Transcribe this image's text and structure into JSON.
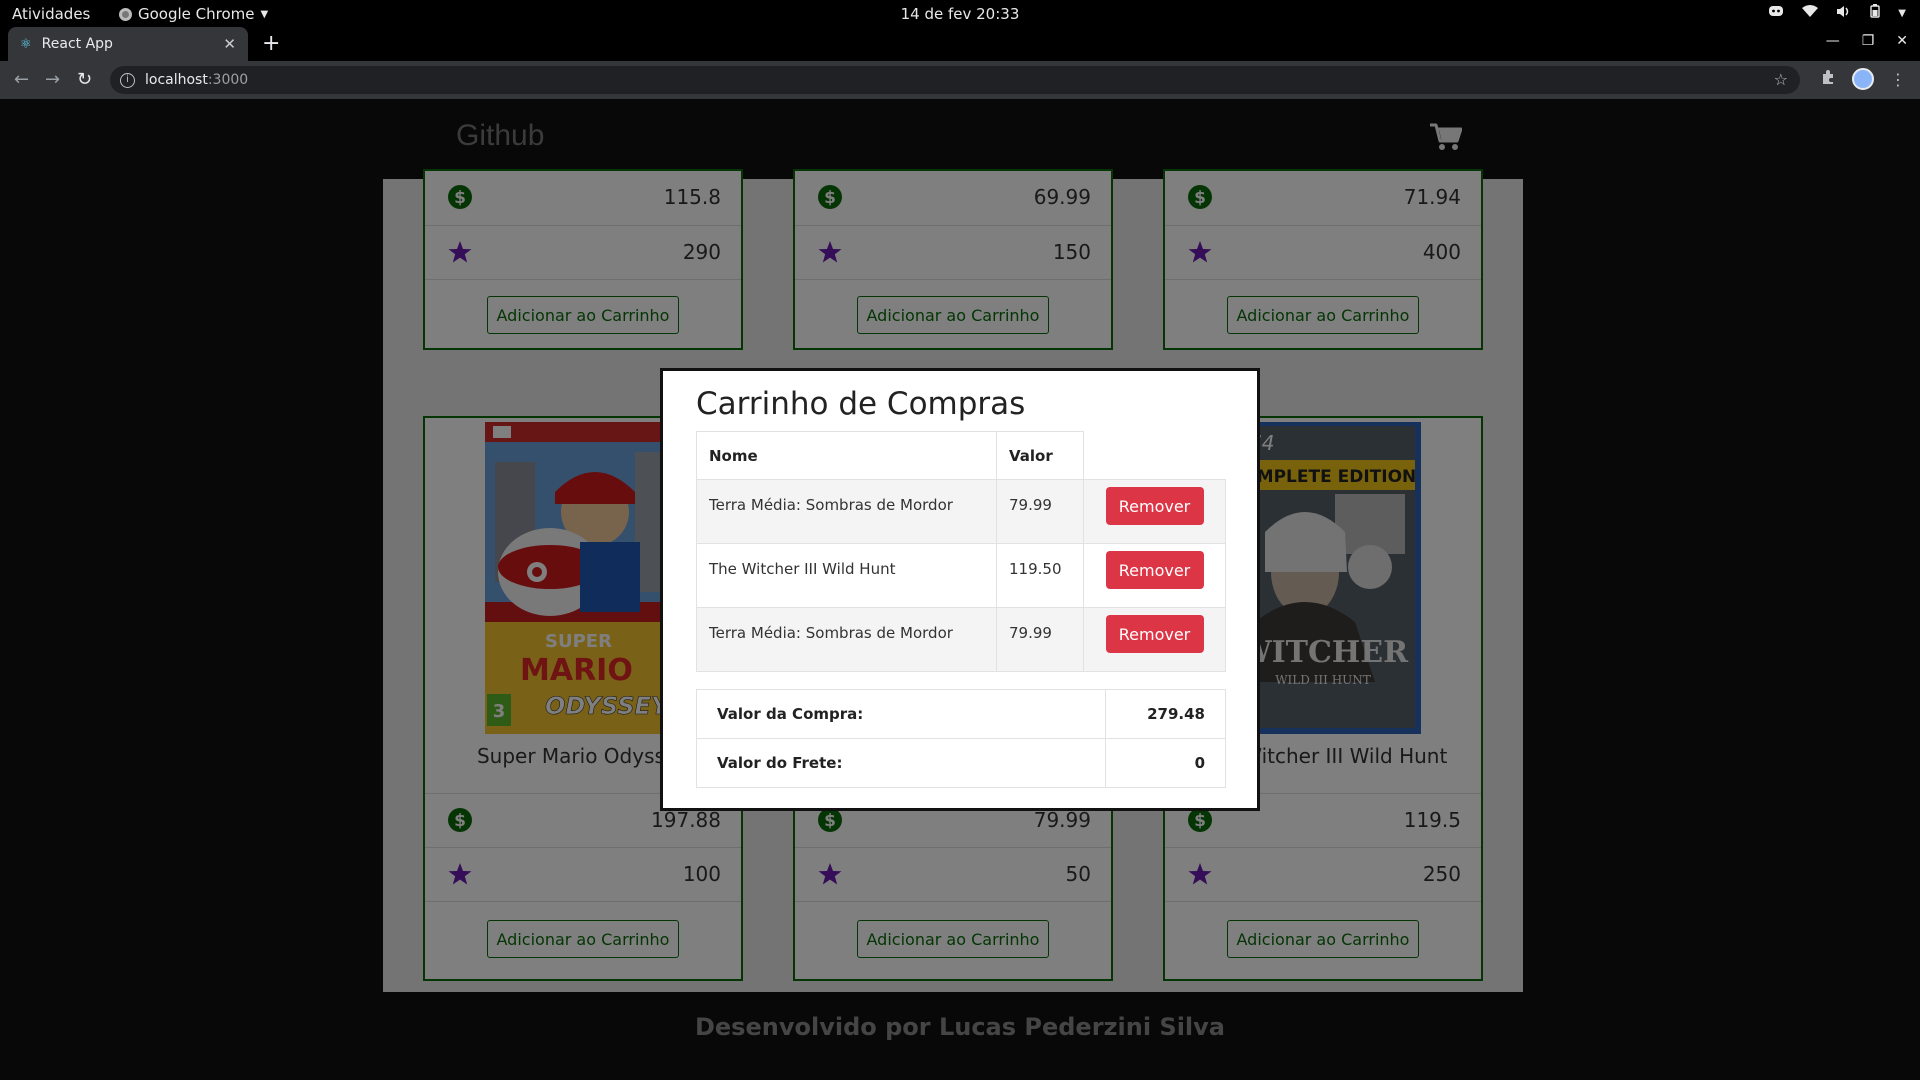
{
  "os": {
    "activities": "Atividades",
    "app_name": "Google Chrome",
    "clock": "14 de fev  20:33"
  },
  "browser": {
    "tab_title": "React App",
    "url_host": "localhost",
    "url_port": ":3000"
  },
  "site": {
    "brand": "Github",
    "footer": "Desenvolvido por Lucas Pederzini Silva",
    "add_label": "Adicionar ao Carrinho",
    "accent_color": "#0a6b0a",
    "star_color": "#6a1bb0",
    "top_cards": [
      {
        "price": "115.8",
        "score": "290"
      },
      {
        "price": "69.99",
        "score": "150"
      },
      {
        "price": "71.94",
        "score": "400"
      }
    ],
    "bottom_cards": [
      {
        "name": "Super Mario Odyssey",
        "price": "197.88",
        "score": "100"
      },
      {
        "name": "",
        "price": "79.99",
        "score": "50"
      },
      {
        "name": "The Witcher III Wild Hunt",
        "price": "119.5",
        "score": "250"
      }
    ]
  },
  "modal": {
    "title": "Carrinho de Compras",
    "col_name": "Nome",
    "col_value": "Valor",
    "remove_label": "Remover",
    "remove_color": "#dc3545",
    "items": [
      {
        "name": "Terra Média: Sombras de Mordor",
        "value": "79.99"
      },
      {
        "name": "The Witcher III Wild Hunt",
        "value": "119.50"
      },
      {
        "name": "Terra Média: Sombras de Mordor",
        "value": "79.99"
      }
    ],
    "purchase_label": "Valor da Compra:",
    "purchase_value": "279.48",
    "shipping_label": "Valor do Frete:",
    "shipping_value": "0"
  }
}
